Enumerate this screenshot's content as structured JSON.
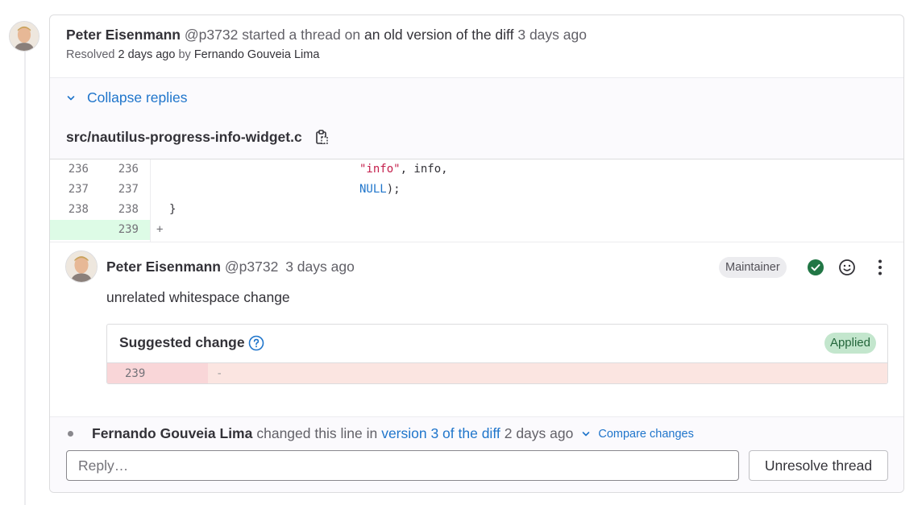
{
  "thread": {
    "author_name": "Peter Eisenmann",
    "author_handle": "@p3732",
    "started_text": "started a thread on",
    "diff_version_link": "an old version of the diff",
    "time": "3 days ago",
    "resolved_prefix": "Resolved",
    "resolved_time": "2 days ago",
    "resolved_by_word": "by",
    "resolved_by": "Fernando Gouveia Lima"
  },
  "replies": {
    "collapse_label": "Collapse replies",
    "file_path": "src/nautilus-progress-info-widget.c"
  },
  "diff": {
    "lines": [
      {
        "old": "236",
        "new": "236",
        "str": "\"info\"",
        "rest": ", info,"
      },
      {
        "old": "237",
        "new": "237",
        "kw": "NULL",
        "rest": ");"
      },
      {
        "old": "238",
        "new": "238",
        "text": "}"
      },
      {
        "old": "",
        "new": "239",
        "text": "+"
      }
    ]
  },
  "note": {
    "author_name": "Peter Eisenmann",
    "author_handle": "@p3732",
    "time": "3 days ago",
    "role_badge": "Maintainer",
    "body": "unrelated whitespace change",
    "suggestion": {
      "title": "Suggested change",
      "status": "Applied",
      "line_number": "239",
      "line_text": "-"
    }
  },
  "system_note": {
    "author": "Fernando Gouveia Lima",
    "text": "changed this line in",
    "link": "version 3 of the diff",
    "time": "2 days ago",
    "compare_label": "Compare changes"
  },
  "reply": {
    "placeholder": "Reply…",
    "unresolve_label": "Unresolve thread"
  },
  "colors": {
    "link": "#1f75cb",
    "resolved_check": "#217645",
    "added_line_bg": "#ddfbe6",
    "removed_line_bg": "#fbe5e1"
  }
}
